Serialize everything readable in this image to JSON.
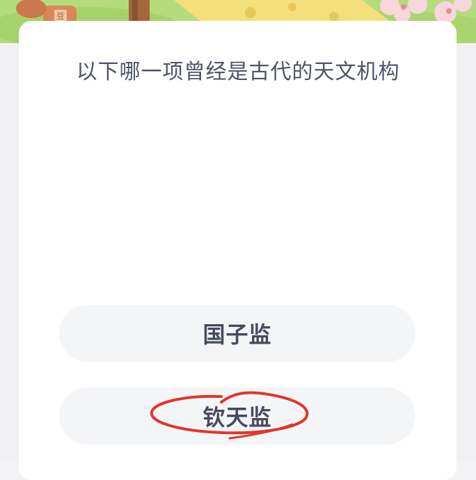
{
  "quiz": {
    "question": "以下哪一项曾经是古代的天文机构",
    "options": [
      {
        "label": "国子监"
      },
      {
        "label": "钦天监"
      }
    ]
  },
  "colors": {
    "banner_green": "#a8d774",
    "card_bg": "#ffffff",
    "page_bg": "#f3f3f5",
    "option_bg": "#f4f5f7",
    "text": "#4d5468",
    "annotation_red": "#e0362b"
  }
}
